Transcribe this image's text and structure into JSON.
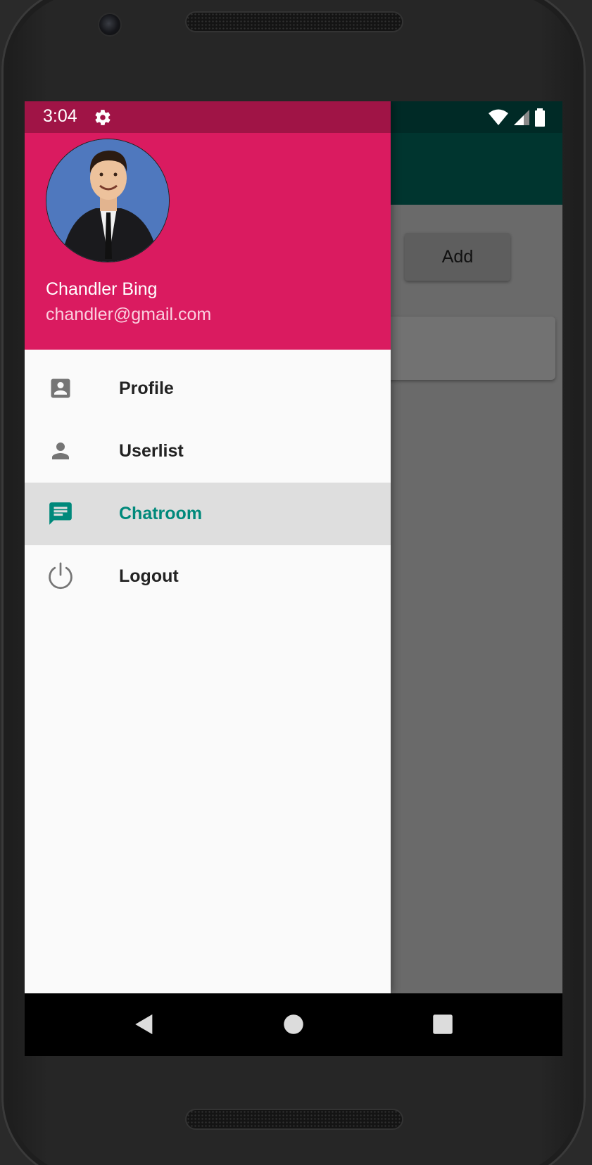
{
  "status_bar": {
    "time": "3:04",
    "icons": [
      "gear-icon",
      "wifi-icon",
      "signal-icon",
      "battery-icon"
    ]
  },
  "drawer": {
    "header_color": "#da1b60",
    "user": {
      "name": "Chandler Bing",
      "email": "chandler@gmail.com"
    },
    "menu": [
      {
        "label": "Profile",
        "icon": "account-box-icon",
        "active": false
      },
      {
        "label": "Userlist",
        "icon": "person-icon",
        "active": false
      },
      {
        "label": "Chatroom",
        "icon": "chat-icon",
        "active": true
      },
      {
        "label": "Logout",
        "icon": "power-icon",
        "active": false
      }
    ],
    "active_color": "#00897b"
  },
  "background_app": {
    "toolbar_color": "#00352f",
    "add_button_label": "Add"
  },
  "nav_bar": {
    "buttons": [
      "back-icon",
      "home-icon",
      "recents-icon"
    ]
  }
}
